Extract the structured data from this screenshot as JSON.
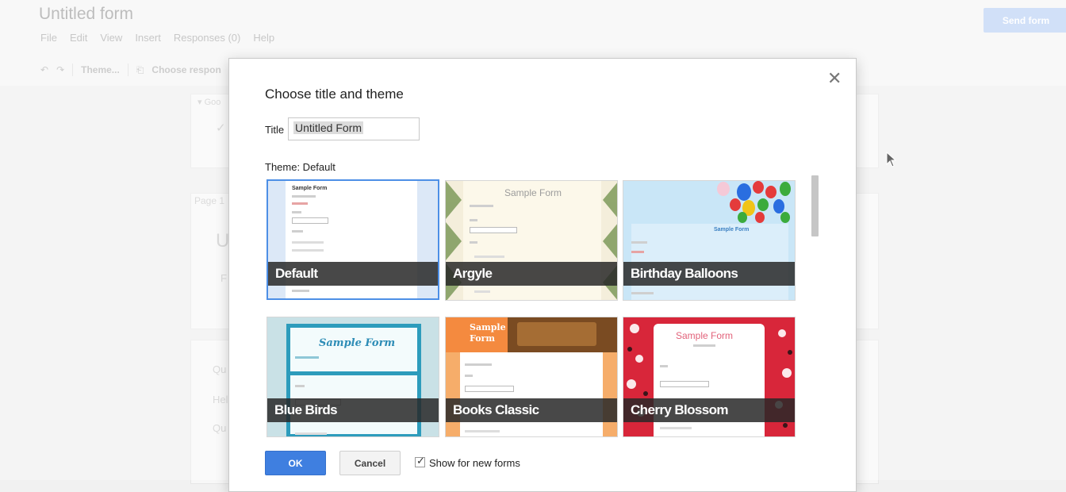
{
  "app": {
    "doc_title": "Untitled form",
    "menu": [
      "File",
      "Edit",
      "View",
      "Insert",
      "Responses (0)",
      "Help"
    ],
    "send_label": "Send form",
    "toolbar": {
      "theme_label": "Theme...",
      "choose_label": "Choose respon"
    },
    "bg_text": {
      "goo": "Goo",
      "page": "Page 1",
      "u": "U",
      "f": "F",
      "qu1": "Qu",
      "hel": "Hel",
      "qu2": "Qu"
    }
  },
  "dialog": {
    "title": "Choose title and theme",
    "title_label": "Title",
    "title_value": "Untitled Form",
    "theme_label": "Theme: Default",
    "themes": [
      {
        "name": "Default",
        "selected": true
      },
      {
        "name": "Argyle",
        "selected": false
      },
      {
        "name": "Birthday Balloons",
        "selected": false
      },
      {
        "name": "Blue Birds",
        "selected": false
      },
      {
        "name": "Books Classic",
        "selected": false
      },
      {
        "name": "Cherry Blossom",
        "selected": false
      }
    ],
    "thumb_text": {
      "sample_form": "Sample Form",
      "sample_form_cursive": "Sample Form",
      "books_line1": "Sample",
      "books_line2": "Form"
    },
    "ok_label": "OK",
    "cancel_label": "Cancel",
    "show_new_forms_label": "Show for new forms",
    "show_new_forms_checked": true
  }
}
